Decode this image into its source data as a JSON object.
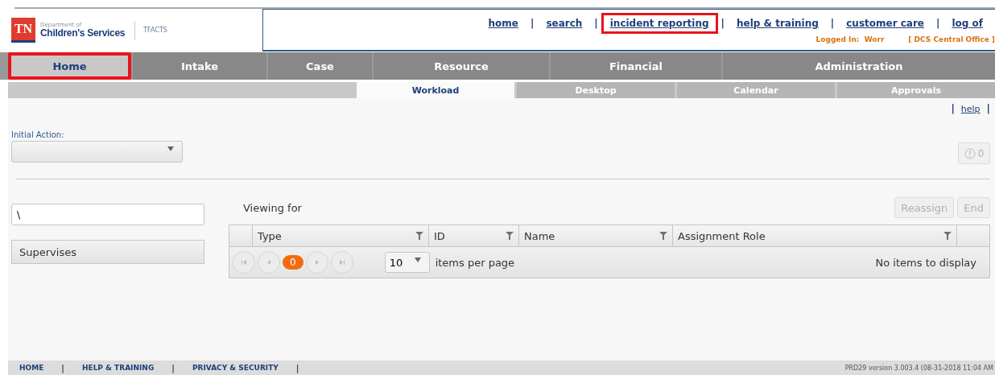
{
  "logo": {
    "state": "TN",
    "department": "Department of",
    "agency": "Children's Services",
    "system": "TFACTS"
  },
  "top_links": [
    {
      "label": "home",
      "highlighted": false
    },
    {
      "separator": "|",
      "label": "search",
      "highlighted": false
    },
    {
      "separator": "|",
      "label": "incident reporting",
      "highlighted": true
    },
    {
      "separator": "|",
      "label": "help & training",
      "highlighted": false
    },
    {
      "separator": "|",
      "label": "customer care",
      "highlighted": false
    },
    {
      "separator": "|",
      "label": "log of",
      "highlighted": false
    }
  ],
  "logged_in": {
    "label": "Logged In:",
    "user": "Worr",
    "office": "[ DCS Central Office ]"
  },
  "main_tabs": [
    {
      "label": "Home",
      "selected": true,
      "highlighted": true
    },
    {
      "label": "Intake",
      "selected": false,
      "highlighted": false
    },
    {
      "label": "Case",
      "selected": false,
      "highlighted": false
    },
    {
      "label": "Resource",
      "selected": false,
      "highlighted": false
    },
    {
      "label": "Financial",
      "selected": false,
      "highlighted": false
    },
    {
      "label": "Administration",
      "selected": false,
      "highlighted": false
    }
  ],
  "sub_tabs": [
    {
      "label": "Workload",
      "selected": true
    },
    {
      "label": "Desktop",
      "selected": false
    },
    {
      "label": "Calendar",
      "selected": false
    },
    {
      "label": "Approvals",
      "selected": false
    }
  ],
  "help_link": {
    "before": "|",
    "label": "help",
    "after": "|"
  },
  "initial_action": {
    "label": "Initial Action:"
  },
  "alert_count": "0",
  "worker_field": {
    "value": "\\"
  },
  "supervises": "Supervises",
  "viewing_for": "Viewing for",
  "buttons": [
    {
      "label": "Reassign",
      "disabled": true
    },
    {
      "label": "End",
      "disabled": true
    }
  ],
  "grid": {
    "columns": [
      "Type",
      "ID",
      "Name",
      "Assignment Role"
    ],
    "page": "0",
    "page_size": "10",
    "page_size_label": "items per page",
    "empty": "No items to display"
  },
  "footer": {
    "links": [
      {
        "label": "HOME",
        "separator": "|"
      },
      {
        "label": "HELP & TRAINING",
        "separator": "|"
      },
      {
        "label": "PRIVACY & SECURITY",
        "separator": "|"
      }
    ],
    "version": "PRD29 version  3.003.4 (08-31-2018 11:04 AM"
  }
}
